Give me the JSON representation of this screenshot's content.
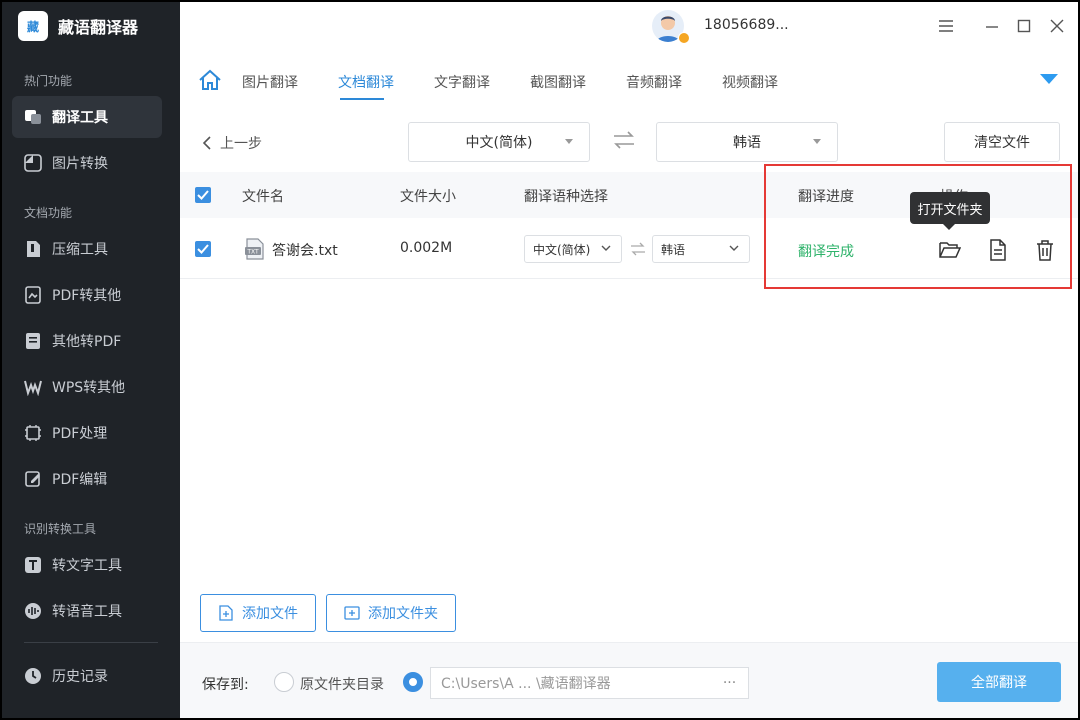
{
  "app": {
    "name": "藏语翻译器",
    "logo_text": "藏"
  },
  "user": {
    "phone": "18056689..."
  },
  "sidebar": {
    "sections": [
      {
        "label": "热门功能"
      },
      {
        "label": "文档功能"
      },
      {
        "label": "识别转换工具"
      }
    ],
    "items": [
      {
        "label": "翻译工具",
        "icon": "translate-icon",
        "active": true
      },
      {
        "label": "图片转换",
        "icon": "image-convert-icon"
      },
      {
        "label": "压缩工具",
        "icon": "compress-icon"
      },
      {
        "label": "PDF转其他",
        "icon": "pdf-convert-icon"
      },
      {
        "label": "其他转PDF",
        "icon": "to-pdf-icon"
      },
      {
        "label": "WPS转其他",
        "icon": "wps-icon"
      },
      {
        "label": "PDF处理",
        "icon": "pdf-process-icon"
      },
      {
        "label": "PDF编辑",
        "icon": "pdf-edit-icon"
      },
      {
        "label": "转文字工具",
        "icon": "to-text-icon"
      },
      {
        "label": "转语音工具",
        "icon": "to-voice-icon"
      },
      {
        "label": "历史记录",
        "icon": "history-icon"
      }
    ]
  },
  "tabs": [
    {
      "label": "图片翻译"
    },
    {
      "label": "文档翻译",
      "active": true
    },
    {
      "label": "文字翻译"
    },
    {
      "label": "截图翻译"
    },
    {
      "label": "音频翻译"
    },
    {
      "label": "视频翻译"
    }
  ],
  "toolbar": {
    "back_label": "上一步",
    "source_lang": "中文(简体)",
    "target_lang": "韩语",
    "clear_label": "清空文件"
  },
  "table": {
    "headers": {
      "name": "文件名",
      "size": "文件大小",
      "lang": "翻译语种选择",
      "progress": "翻译进度",
      "ops": "操作"
    },
    "rows": [
      {
        "name": "答谢会.txt",
        "file_type": "TXT",
        "size": "0.002M",
        "source": "中文(简体)",
        "target": "韩语",
        "status": "翻译完成"
      }
    ]
  },
  "tooltip": {
    "text": "打开文件夹"
  },
  "add": {
    "file_label": "添加文件",
    "folder_label": "添加文件夹"
  },
  "footer": {
    "save_label": "保存到:",
    "option_original": "原文件夹目录",
    "path": "C:\\Users\\A ... \\藏语翻译器",
    "more": "···",
    "translate_all": "全部翻译"
  },
  "colors": {
    "accent": "#3b8fe0",
    "success": "#2fb36b",
    "sidebar_bg": "#1f2328",
    "highlight": "#e53935"
  }
}
